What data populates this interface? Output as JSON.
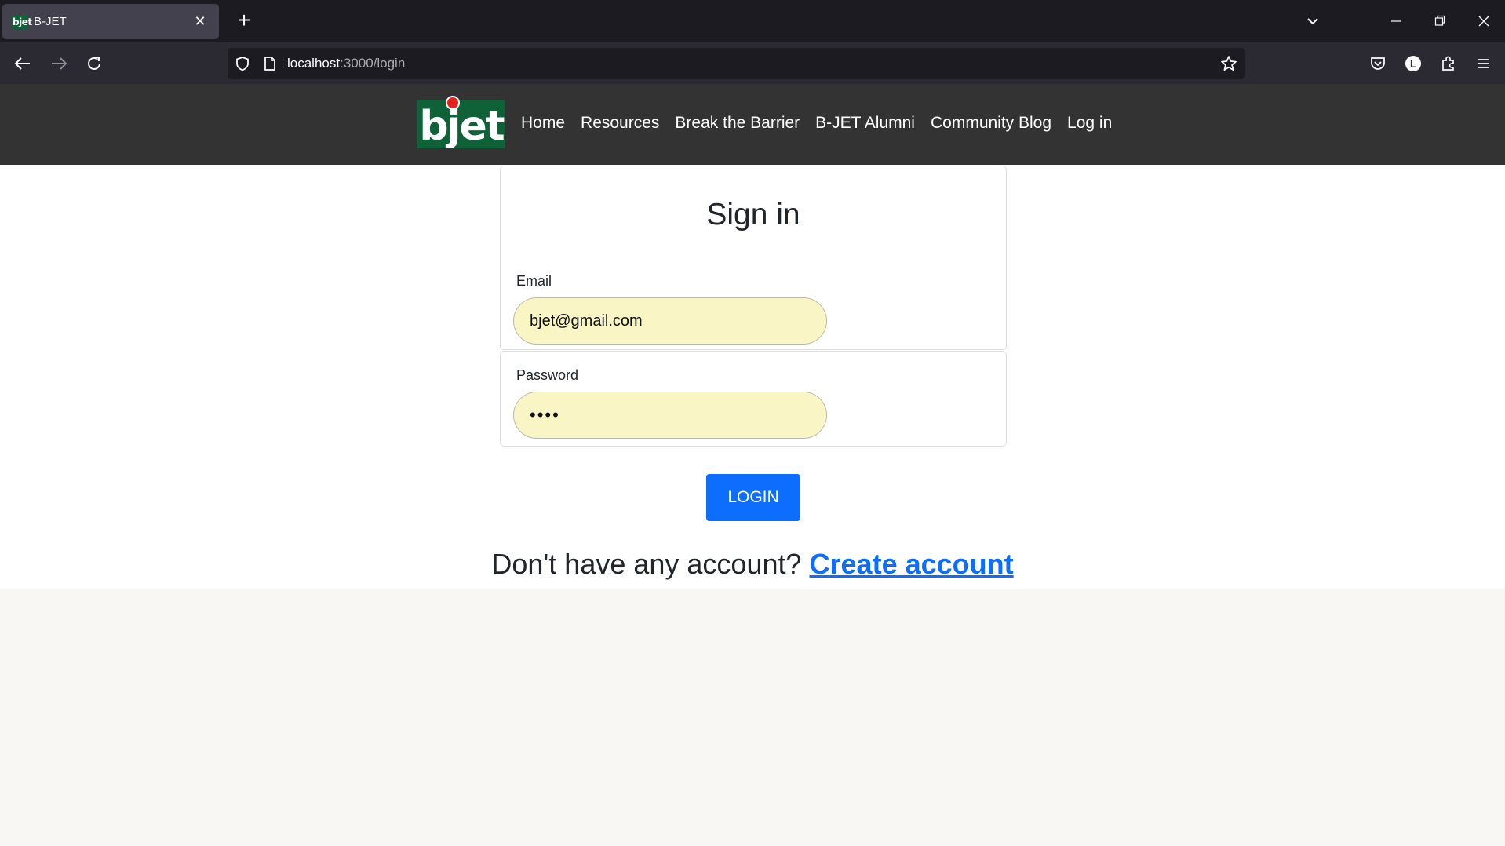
{
  "browser": {
    "tab_title": "B-JET",
    "favicon_text": "bjet",
    "url_host": "localhost",
    "url_path": ":3000/login",
    "profile_initial": "L"
  },
  "site": {
    "logo_text": "bjet",
    "brand_colors": {
      "logo_bg": "#0f6138",
      "logo_dot": "#e3231d",
      "header_bg": "#333333"
    },
    "nav": [
      {
        "label": "Home"
      },
      {
        "label": "Resources"
      },
      {
        "label": "Break the Barrier"
      },
      {
        "label": "B-JET Alumni"
      },
      {
        "label": "Community Blog"
      },
      {
        "label": "Log in"
      }
    ]
  },
  "login_form": {
    "title": "Sign in",
    "email_label": "Email",
    "email_value": "bjet@gmail.com",
    "password_label": "Password",
    "password_value": "••••",
    "submit_label": "LOGIN",
    "accent_color": "#0d6efd",
    "input_bg": "#faf5c5"
  },
  "signup": {
    "prompt": "Don't have any account?",
    "link_label": "Create account"
  }
}
